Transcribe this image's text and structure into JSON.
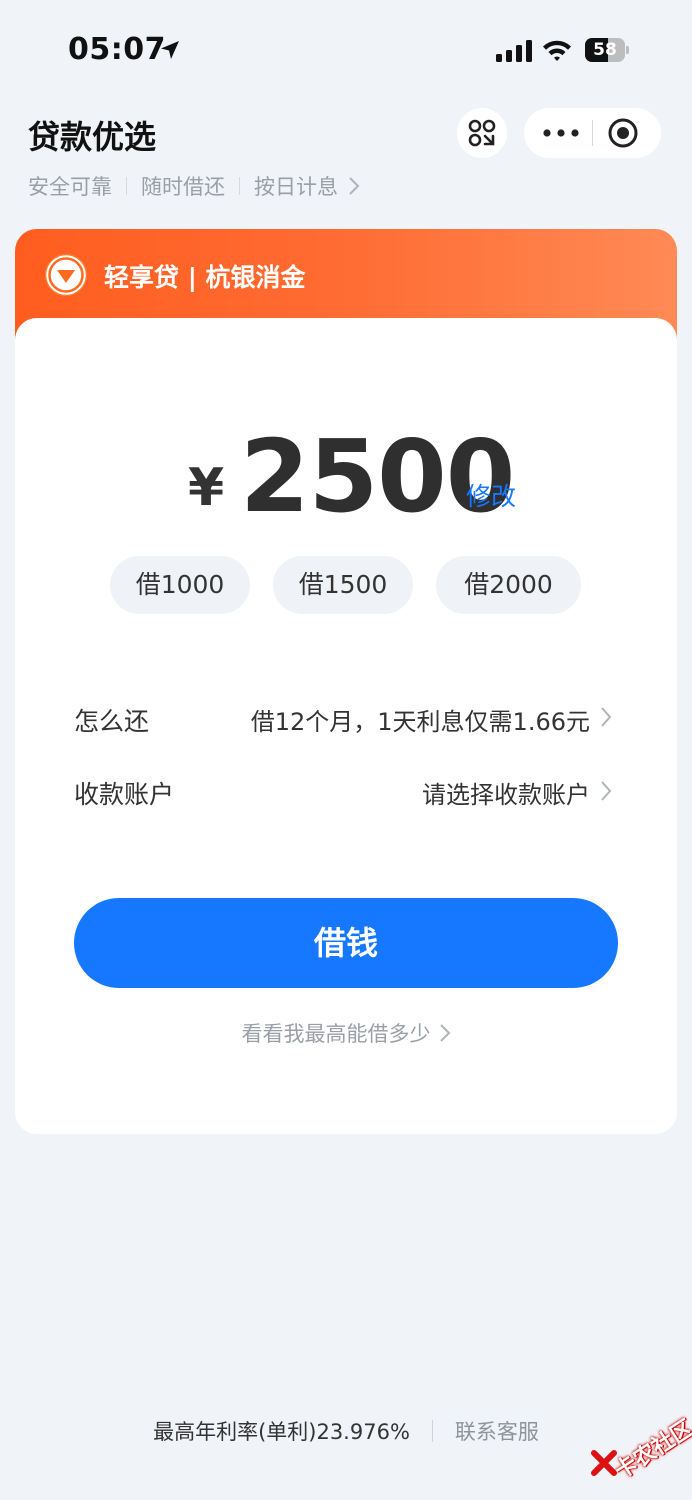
{
  "status_bar": {
    "time": "05:07",
    "battery": "58",
    "battery_level": 0.58
  },
  "header": {
    "title": "贷款优选",
    "tags": [
      "安全可靠",
      "随时借还",
      "按日计息"
    ]
  },
  "card": {
    "brand": "轻享贷 | 杭银消金",
    "currency": "¥",
    "amount": "2500",
    "edit_label": "修改",
    "quick_amounts": [
      "借1000",
      "借1500",
      "借2000"
    ],
    "repay_label": "怎么还",
    "repay_value": "借12个月，1天利息仅需1.66元",
    "account_label": "收款账户",
    "account_value": "请选择收款账户",
    "borrow_button": "借钱",
    "max_link": "看看我最高能借多少"
  },
  "footer": {
    "rate": "最高年利率(单利)23.976%",
    "service": "联系客服"
  },
  "watermark": {
    "text": "卡农社区"
  },
  "colors": {
    "accent_blue": "#1677ff",
    "brand_orange": "#ff5d1f",
    "page_bg": "#f0f3f8"
  },
  "icons": [
    "location-arrow-icon",
    "signal-icon",
    "wifi-icon",
    "battery-icon",
    "scan-icon",
    "more-icon",
    "close-icon",
    "chevron-right-icon",
    "brand-logo-icon"
  ]
}
